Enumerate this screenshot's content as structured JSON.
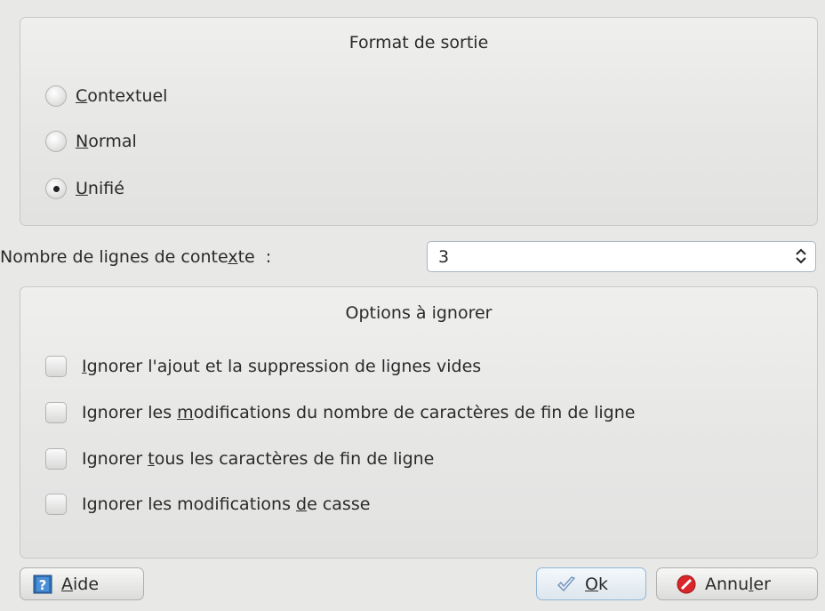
{
  "output_format": {
    "title": "Format de sortie",
    "options": [
      {
        "pre": "",
        "key": "C",
        "post": "ontextuel",
        "selected": false
      },
      {
        "pre": "",
        "key": "N",
        "post": "ormal",
        "selected": false
      },
      {
        "pre": "",
        "key": "U",
        "post": "nifié",
        "selected": true
      }
    ]
  },
  "context_lines": {
    "label_pre": "Nombre de lignes de conte",
    "label_key": "x",
    "label_post": "te  :",
    "value": "3"
  },
  "ignore_options": {
    "title": "Options à ignorer",
    "items": [
      {
        "pre": "",
        "key": "I",
        "post": "gnorer l'ajout et la suppression de lignes vides",
        "checked": false
      },
      {
        "pre": "Ignorer les ",
        "key": "m",
        "post": "odifications du nombre de caractères de fin de ligne",
        "checked": false
      },
      {
        "pre": "Ignorer ",
        "key": "t",
        "post": "ous les caractères de fin de ligne",
        "checked": false
      },
      {
        "pre": "Ignorer les modifications ",
        "key": "d",
        "post": "e casse",
        "checked": false
      }
    ]
  },
  "buttons": {
    "help": {
      "pre": "",
      "key": "A",
      "post": "ide",
      "icon": "help-book-icon"
    },
    "ok": {
      "pre": "",
      "key": "O",
      "post": "k",
      "icon": "checkmark-icon"
    },
    "cancel": {
      "pre": "Annu",
      "key": "l",
      "post": "er",
      "icon": "cancel-icon"
    }
  },
  "colors": {
    "help_icon": "#2f6fb5",
    "cancel_icon": "#d9262a",
    "ok_check": "#6c8fb8"
  }
}
